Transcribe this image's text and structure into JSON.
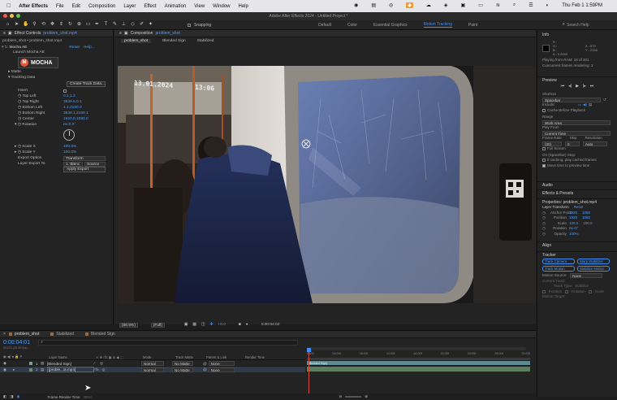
{
  "menubar": {
    "app_name": "After Effects",
    "items": [
      "File",
      "Edit",
      "Composition",
      "Layer",
      "Effect",
      "Animation",
      "View",
      "Window",
      "Help"
    ],
    "clock": "Thu Feb 1  1:59PM"
  },
  "window": {
    "title": "Adobe After Effects 2024 - Untitled Project *"
  },
  "toolbar": {
    "snapping_label": "Snapping",
    "workspaces": [
      "Default",
      "Color",
      "Essential Graphics",
      "Motion Tracking",
      "Paint"
    ],
    "active_workspace": "Motion Tracking",
    "search_placeholder": "Search Help"
  },
  "effect_controls": {
    "tab_label": "Effect Controls",
    "tab_file": "problem_shot.mp4",
    "breadcrumb": "problem_shot • problem_shot.mp4",
    "effect_name": "Mocha AE",
    "reset_label": "Reset",
    "help_label": "Help...",
    "launch_label": "Launch Mocha AE",
    "logo_text": "MOCHA",
    "matte_label": "Matte",
    "tracking_label": "Tracking Data",
    "create_btn": "Create Track Data...",
    "rows": [
      {
        "label": "Insert",
        "value": ""
      },
      {
        "label": "Top Left",
        "value": "0.1,1.2"
      },
      {
        "label": "Top Right",
        "value": "3839.6,0.1"
      },
      {
        "label": "Bottom Left",
        "value": "1.1,2160.0"
      },
      {
        "label": "Bottom Right",
        "value": "3839.1,2159.1"
      },
      {
        "label": "Center",
        "value": "1920.0,1080.0"
      },
      {
        "label": "Rotation",
        "value": "0x-0.0°"
      }
    ],
    "scale_x_label": "Scale X",
    "scale_x_value": "100.0%",
    "scale_y_label": "Scale Y",
    "scale_y_value": "100.0%",
    "export_option_label": "Export Option",
    "export_option_value": "Transform",
    "layer_export_label": "Layer Export To",
    "layer_export_value": "1. Blenc",
    "layer_export_source": "Source",
    "apply_export_btn": "Apply Export"
  },
  "composition": {
    "tab_label": "Composition",
    "tab_file": "problem_shot",
    "subtabs": [
      "problem_shot",
      "Blended Sign",
      "Stabilized"
    ],
    "video_timestamp": "13.01.2024",
    "video_clock": "13:06",
    "zoom": "(66.9%)",
    "resolution": "(Full)",
    "exposure": "+0.0",
    "current_time": "0:00:04:02"
  },
  "info_panel": {
    "title": "Info",
    "r": "R :",
    "g": "G :",
    "b": "B :",
    "a": "A :  0.0000",
    "x": "X : 579",
    "y": "Y : 2158",
    "playing": "Playing from RAM: 18 of 201",
    "concurrent": "Concurrent frames rendering: 2"
  },
  "preview_panel": {
    "title": "Preview",
    "shortcut_label": "Shortcut",
    "shortcut_value": "Spacebar",
    "include_label": "Include:",
    "cache_label": "Cache Before Playback",
    "range_label": "Range",
    "range_value": "Work Area",
    "play_from_label": "Play From",
    "play_from_value": "Current Time",
    "frame_rate_label": "Frame Rate",
    "skip_label": "Skip",
    "resolution_label": "Resolution",
    "frame_rate_value": "(30)",
    "skip_value": "0",
    "resolution_value": "Auto",
    "full_screen_label": "Full Screen",
    "on_stop_label": "On (Spacebar) Stop:",
    "if_caching_label": "If caching, play cached frames",
    "move_time_label": "Move time to preview time"
  },
  "right_misc": {
    "audio": "Audio",
    "effects_presets": "Effects & Presets",
    "properties_title": "Properties: problem_shot.mp4",
    "layer_transform": "Layer Transform",
    "reset": "Reset",
    "anchor_label": "Anchor Point",
    "anchor_x": "1920",
    "anchor_y": "1080",
    "position_label": "Position",
    "position_x": "1920",
    "position_y": "1080",
    "scale_label": "Scale",
    "scale_x": "100.0",
    "scale_y": "100.0",
    "rotation_label": "Rotation",
    "rotation_value": "0x+0°",
    "opacity_label": "Opacity",
    "opacity_value": "100%",
    "align": "Align",
    "tracker": "Tracker",
    "track_camera": "Track Camera",
    "warp_stabilizer": "Warp Stabilizer",
    "track_motion": "Track Motion",
    "stabilize_motion": "Stabilize Motion",
    "motion_source_label": "Motion Source:",
    "motion_source_value": "None",
    "current_track": "Current Track:",
    "track_type": "Track Type:",
    "track_type_value": "Stabilize",
    "position_cb": "Position",
    "rotation_cb": "Rotation",
    "scale_cb": "Scale",
    "motion_target": "Motion Target:"
  },
  "timeline": {
    "tabs": [
      "problem_shot",
      "Stabilized",
      "Blended Sign"
    ],
    "current_time": "0:00:04:01",
    "fps_info": "00121 (30.00 fps)",
    "columns": {
      "layer_name": "Layer Name",
      "mode": "Mode",
      "track_matte": "Track Matte",
      "parent": "Parent & Link",
      "render_time": "Render Time"
    },
    "ruler": [
      "0:00f",
      "04:00f",
      "08:00f",
      "12:00f",
      "16:00f",
      "20:00f",
      "24:00f",
      "28:00f",
      "32:00f"
    ],
    "layers": [
      {
        "num": "1",
        "name": "[Blended Sign]",
        "mode": "Normal",
        "matte": "No Matte",
        "parent": "None",
        "color": "#7a9ea6"
      },
      {
        "num": "2",
        "name": "[proble...ot.mp4]",
        "mode": "Normal",
        "matte": "No Matte",
        "parent": "None",
        "color": "#6f8a6e"
      }
    ],
    "bottom_label": "Frame Render Time",
    "bottom_value": "48ms"
  },
  "colors": {
    "accent": "#3e8ef7",
    "layer1_bar": "#5d8a90",
    "layer2_bar": "#5d7d5c",
    "playhead": "#d14a3b"
  }
}
